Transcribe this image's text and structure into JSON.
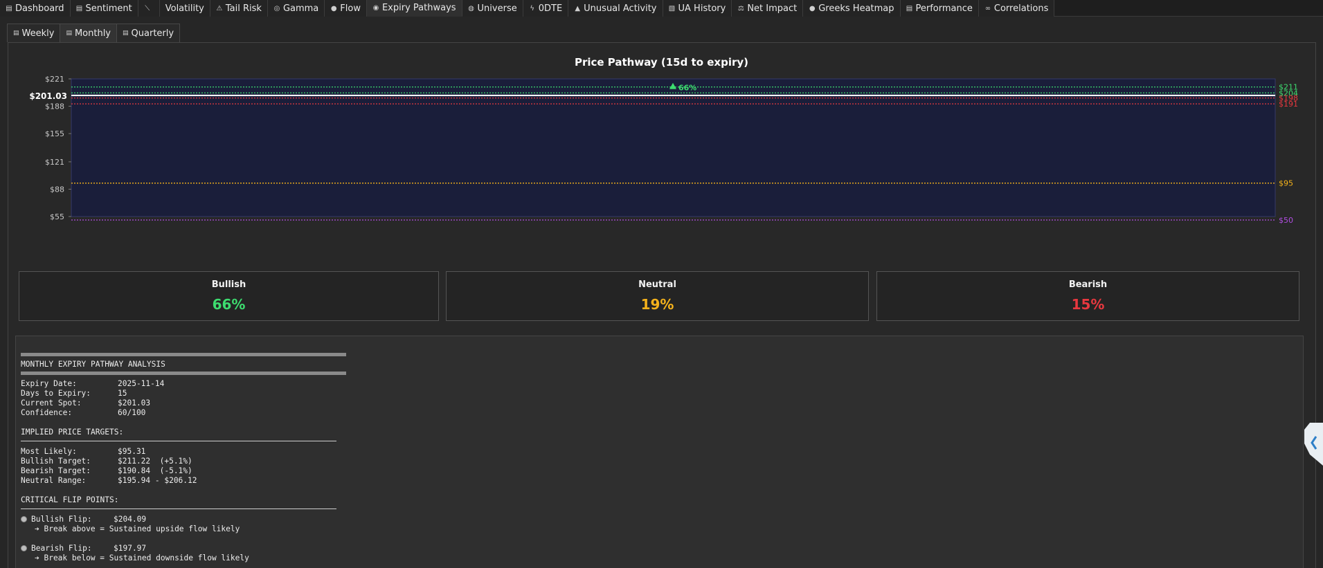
{
  "tabs": [
    {
      "icon": "dashboard-icon",
      "glyph": "▤",
      "label": "Dashboard"
    },
    {
      "icon": "sentiment-icon",
      "glyph": "▤",
      "label": "Sentiment"
    },
    {
      "icon": "pathway-icon",
      "glyph": "⟍",
      "label": ""
    },
    {
      "icon": "volatility-icon",
      "glyph": "",
      "label": "Volatility"
    },
    {
      "icon": "warning-icon",
      "glyph": "⚠",
      "label": "Tail Risk"
    },
    {
      "icon": "gamma-icon",
      "glyph": "◎",
      "label": "Gamma"
    },
    {
      "icon": "flow-icon",
      "glyph": "●",
      "label": "Flow"
    },
    {
      "icon": "expiry-icon",
      "glyph": "◉",
      "label": "Expiry Pathways"
    },
    {
      "icon": "globe-icon",
      "glyph": "◍",
      "label": "Universe"
    },
    {
      "icon": "lightning-icon",
      "glyph": "ϟ",
      "label": "0DTE"
    },
    {
      "icon": "alert-icon",
      "glyph": "▲",
      "label": "Unusual Activity"
    },
    {
      "icon": "history-icon",
      "glyph": "▧",
      "label": "UA History"
    },
    {
      "icon": "impact-icon",
      "glyph": "⚖",
      "label": "Net Impact"
    },
    {
      "icon": "heatmap-icon",
      "glyph": "●",
      "label": "Greeks Heatmap"
    },
    {
      "icon": "performance-icon",
      "glyph": "▤",
      "label": "Performance"
    },
    {
      "icon": "correlation-icon",
      "glyph": "∞",
      "label": "Correlations"
    }
  ],
  "active_tab": "Expiry Pathways",
  "subtabs": [
    {
      "glyph": "▤",
      "label": "Weekly"
    },
    {
      "glyph": "▤",
      "label": "Monthly"
    },
    {
      "glyph": "▤",
      "label": "Quarterly"
    }
  ],
  "active_subtab": "Monthly",
  "colors": {
    "bullish": "#3ddc6f",
    "neutral": "#f5b21b",
    "bearish": "#e8383f",
    "plot_bg": "#1a1e3a",
    "purple": "#b04de0"
  },
  "chart_data": {
    "type": "line",
    "title": "Price Pathway (15d to expiry)",
    "ylim": [
      50,
      221
    ],
    "y_ticks": [
      "$221",
      "$188",
      "$155",
      "$121",
      "$88",
      "$55"
    ],
    "y_tick_values": [
      221,
      188,
      155,
      121,
      88,
      55
    ],
    "spot": {
      "label": "$201.03",
      "value": 201.03
    },
    "levels": [
      {
        "label": "$211",
        "value": 211.22,
        "color": "#3ddc6f"
      },
      {
        "label": "$204",
        "value": 204.09,
        "color": "#3ddc6f"
      },
      {
        "label": "$198",
        "value": 197.97,
        "color": "#e8383f"
      },
      {
        "label": "$191",
        "value": 190.84,
        "color": "#e8383f"
      },
      {
        "label": "$95",
        "value": 95.31,
        "color": "#f5b21b"
      },
      {
        "label": "$50",
        "value": 50,
        "color": "#b04de0"
      }
    ],
    "marker": {
      "label": "66%",
      "value": 211.22,
      "color": "#3ddc6f"
    }
  },
  "scenarios": [
    {
      "label": "Bullish",
      "value": "66%",
      "color": "#3ddc6f"
    },
    {
      "label": "Neutral",
      "value": "19%",
      "color": "#f5b21b"
    },
    {
      "label": "Bearish",
      "value": "15%",
      "color": "#e8383f"
    }
  ],
  "analysis": {
    "heading": "MONTHLY EXPIRY PATHWAY ANALYSIS",
    "summary": [
      {
        "k": "Expiry Date:",
        "v": "2025-11-14"
      },
      {
        "k": "Days to Expiry:",
        "v": "15"
      },
      {
        "k": "Current Spot:",
        "v": "$201.03"
      },
      {
        "k": "Confidence:",
        "v": "60/100"
      }
    ],
    "targets_heading": "IMPLIED PRICE TARGETS:",
    "targets": [
      {
        "k": "Most Likely:",
        "v": "$95.31"
      },
      {
        "k": "Bullish Target:",
        "v": "$211.22  (+5.1%)"
      },
      {
        "k": "Bearish Target:",
        "v": "$190.84  (-5.1%)"
      },
      {
        "k": "Neutral Range:",
        "v": "$195.94 - $206.12"
      }
    ],
    "flip_heading": "CRITICAL FLIP POINTS:",
    "flips": [
      {
        "k": "Bullish Flip:",
        "v": "$204.09",
        "note": "➔ Break above = Sustained upside flow likely"
      },
      {
        "k": "Bearish Flip:",
        "v": "$197.97",
        "note": "➔ Break below = Sustained downside flow likely"
      }
    ]
  }
}
